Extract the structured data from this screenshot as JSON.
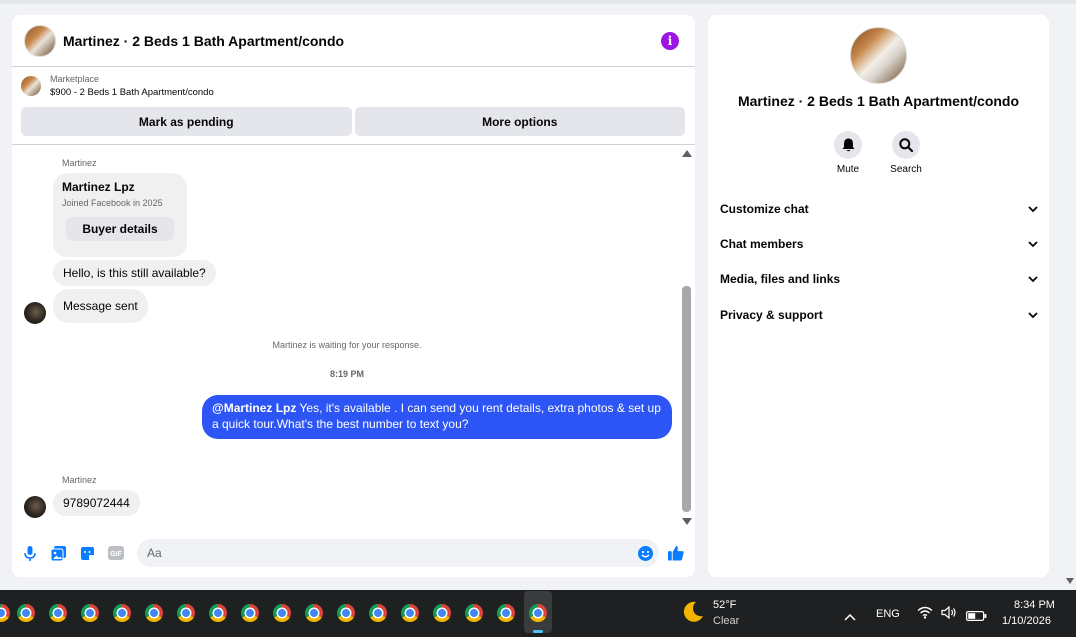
{
  "chat": {
    "title": "Martinez · 2 Beds 1 Bath Apartment/condo",
    "marketplace_label": "Marketplace",
    "listing": "$900 - 2 Beds 1 Bath Apartment/condo",
    "mark_pending_label": "Mark as pending",
    "more_options_label": "More options"
  },
  "messages": {
    "sender_name_1": "Martinez",
    "card": {
      "name": "Martinez Lpz",
      "joined": "Joined Facebook in 2025",
      "button": "Buyer details"
    },
    "msg_1": "Hello, is this still available?",
    "msg_2": "Message sent",
    "waiting": "Martinez is waiting for your response.",
    "time": "8:19 PM",
    "out_mention": "@Martinez Lpz",
    "out_text": " Yes, it's available .  I can send you rent details, extra photos & set up a quick tour.What's the best number to text you?",
    "sender_name_2": "Martinez",
    "msg_3": "9789072444"
  },
  "composer": {
    "placeholder": "Aa"
  },
  "side": {
    "title": "Martinez · 2 Beds 1 Bath Apartment/condo",
    "mute_label": "Mute",
    "search_label": "Search",
    "rows": [
      "Customize chat",
      "Chat members",
      "Media, files and links",
      "Privacy & support"
    ]
  },
  "taskbar": {
    "temp": "52°F",
    "weather": "Clear",
    "lang": "ENG",
    "time": "8:34 PM",
    "date": "1/10/2026"
  },
  "colors": {
    "accent_blue": "#2d55f5",
    "info_purple": "#9b16e3",
    "icon_blue": "#0a7cff"
  }
}
